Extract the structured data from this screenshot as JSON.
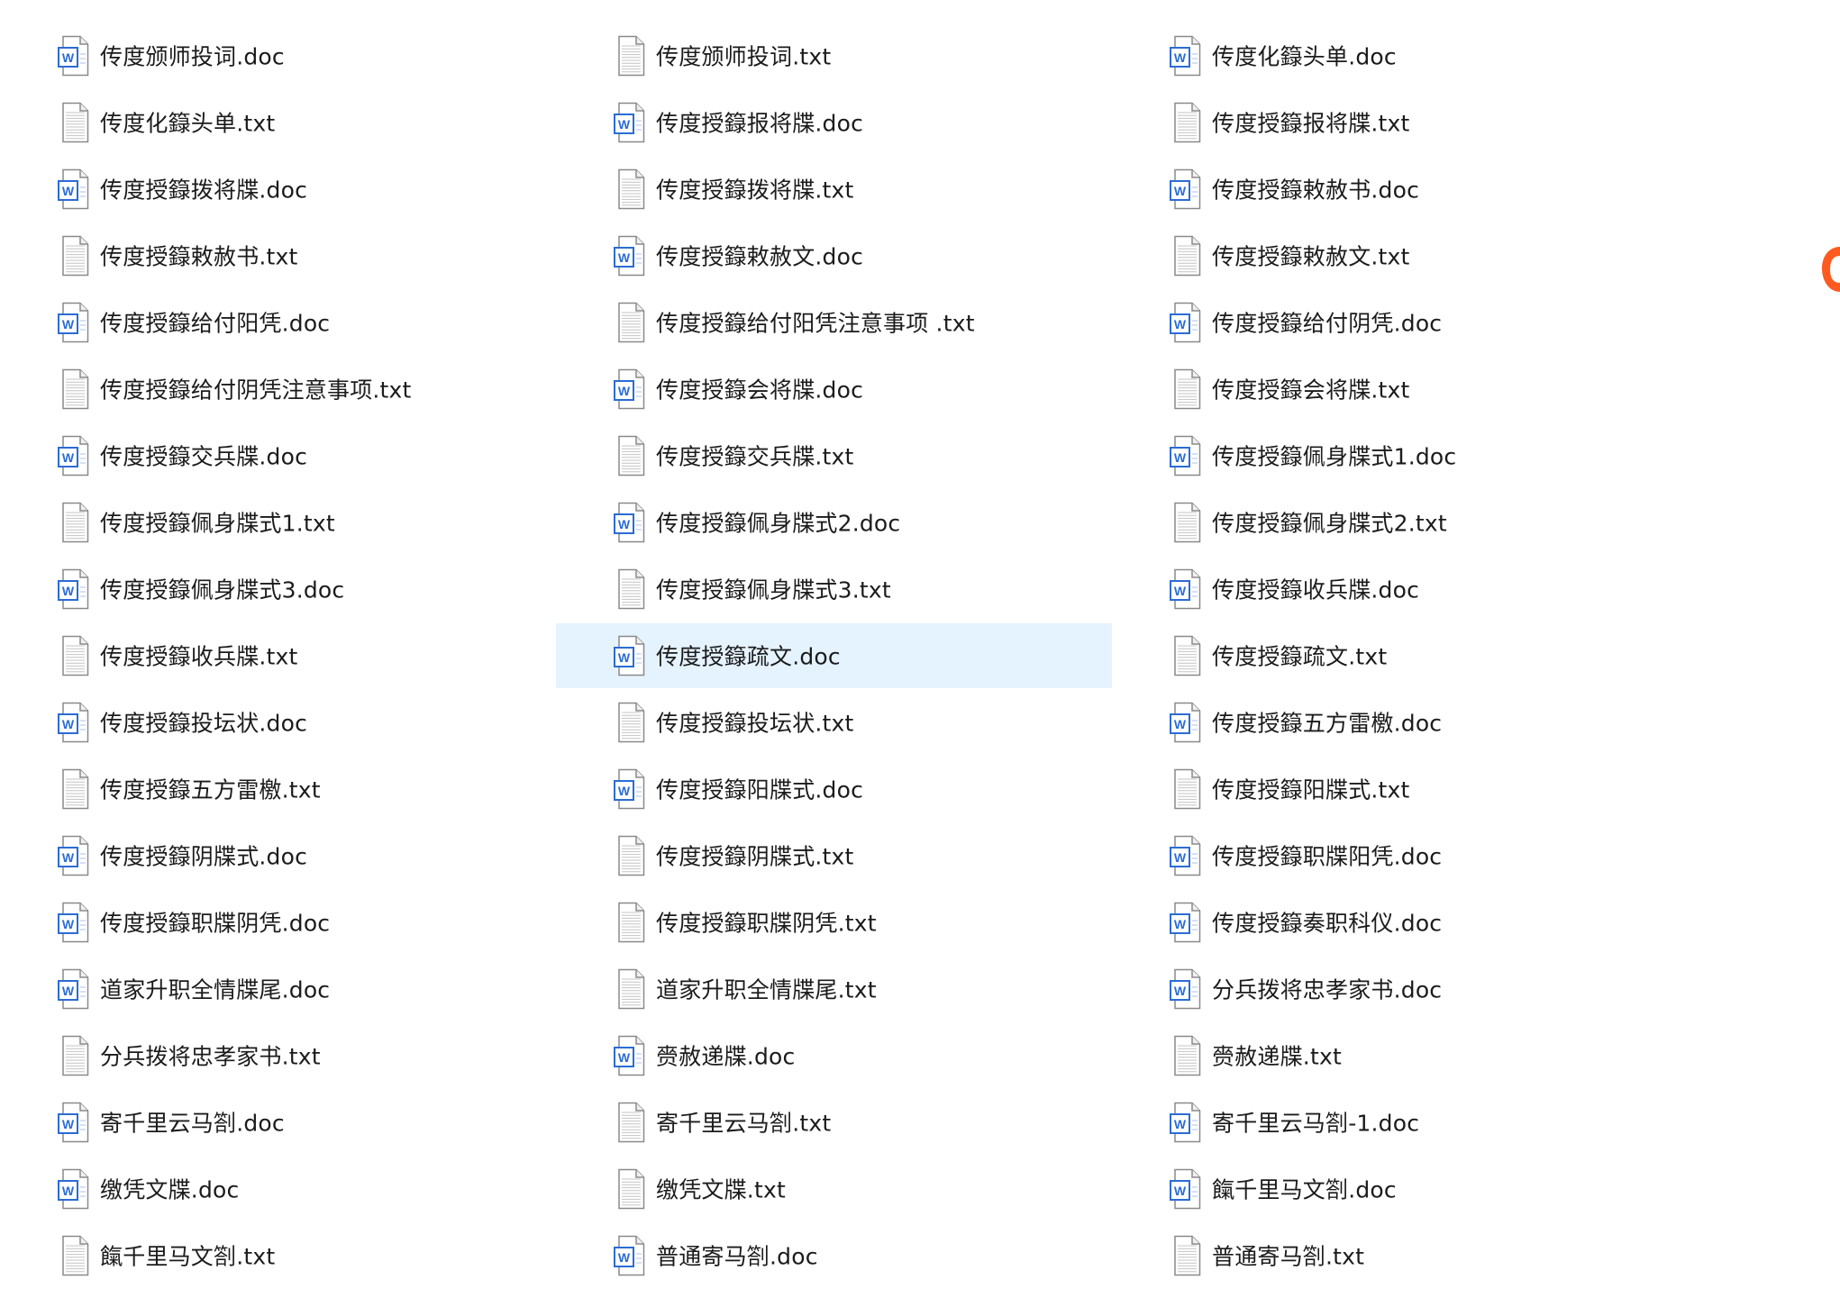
{
  "colors": {
    "selection": "#e5f3ff",
    "text": "#1b1b1b",
    "word_blue": "#2b6cd4",
    "edge_logo": "#ff5a1f"
  },
  "selected_file": "传度授籙疏文.doc",
  "files": [
    {
      "name": "传度颁师投词.doc",
      "type": "doc"
    },
    {
      "name": "传度颁师投词.txt",
      "type": "txt"
    },
    {
      "name": "传度化籙头单.doc",
      "type": "doc"
    },
    {
      "name": "传度化籙头单.txt",
      "type": "txt"
    },
    {
      "name": "传度授籙报将牒.doc",
      "type": "doc"
    },
    {
      "name": "传度授籙报将牒.txt",
      "type": "txt"
    },
    {
      "name": "传度授籙拨将牒.doc",
      "type": "doc"
    },
    {
      "name": "传度授籙拨将牒.txt",
      "type": "txt"
    },
    {
      "name": "传度授籙敕赦书.doc",
      "type": "doc"
    },
    {
      "name": "传度授籙敕赦书.txt",
      "type": "txt"
    },
    {
      "name": "传度授籙敕赦文.doc",
      "type": "doc"
    },
    {
      "name": "传度授籙敕赦文.txt",
      "type": "txt"
    },
    {
      "name": "传度授籙给付阳凭.doc",
      "type": "doc"
    },
    {
      "name": "传度授籙给付阳凭注意事项 .txt",
      "type": "txt"
    },
    {
      "name": "传度授籙给付阴凭.doc",
      "type": "doc"
    },
    {
      "name": "传度授籙给付阴凭注意事项.txt",
      "type": "txt"
    },
    {
      "name": "传度授籙会将牒.doc",
      "type": "doc"
    },
    {
      "name": "传度授籙会将牒.txt",
      "type": "txt"
    },
    {
      "name": "传度授籙交兵牒.doc",
      "type": "doc"
    },
    {
      "name": "传度授籙交兵牒.txt",
      "type": "txt"
    },
    {
      "name": "传度授籙佩身牒式1.doc",
      "type": "doc"
    },
    {
      "name": "传度授籙佩身牒式1.txt",
      "type": "txt"
    },
    {
      "name": "传度授籙佩身牒式2.doc",
      "type": "doc"
    },
    {
      "name": "传度授籙佩身牒式2.txt",
      "type": "txt"
    },
    {
      "name": "传度授籙佩身牒式3.doc",
      "type": "doc"
    },
    {
      "name": "传度授籙佩身牒式3.txt",
      "type": "txt"
    },
    {
      "name": "传度授籙收兵牒.doc",
      "type": "doc"
    },
    {
      "name": "传度授籙收兵牒.txt",
      "type": "txt"
    },
    {
      "name": "传度授籙疏文.doc",
      "type": "doc"
    },
    {
      "name": "传度授籙疏文.txt",
      "type": "txt"
    },
    {
      "name": "传度授籙投坛状.doc",
      "type": "doc"
    },
    {
      "name": "传度授籙投坛状.txt",
      "type": "txt"
    },
    {
      "name": "传度授籙五方雷檄.doc",
      "type": "doc"
    },
    {
      "name": "传度授籙五方雷檄.txt",
      "type": "txt"
    },
    {
      "name": "传度授籙阳牒式.doc",
      "type": "doc"
    },
    {
      "name": "传度授籙阳牒式.txt",
      "type": "txt"
    },
    {
      "name": "传度授籙阴牒式.doc",
      "type": "doc"
    },
    {
      "name": "传度授籙阴牒式.txt",
      "type": "txt"
    },
    {
      "name": "传度授籙职牒阳凭.doc",
      "type": "doc"
    },
    {
      "name": "传度授籙职牒阴凭.doc",
      "type": "doc"
    },
    {
      "name": "传度授籙职牒阴凭.txt",
      "type": "txt"
    },
    {
      "name": "传度授籙奏职科仪.doc",
      "type": "doc"
    },
    {
      "name": "道家升职全情牒尾.doc",
      "type": "doc"
    },
    {
      "name": "道家升职全情牒尾.txt",
      "type": "txt"
    },
    {
      "name": "分兵拨将忠孝家书.doc",
      "type": "doc"
    },
    {
      "name": "分兵拨将忠孝家书.txt",
      "type": "txt"
    },
    {
      "name": "赍赦递牒.doc",
      "type": "doc"
    },
    {
      "name": "赍赦递牒.txt",
      "type": "txt"
    },
    {
      "name": "寄千里云马劄.doc",
      "type": "doc"
    },
    {
      "name": "寄千里云马劄.txt",
      "type": "txt"
    },
    {
      "name": "寄千里云马劄-1.doc",
      "type": "doc"
    },
    {
      "name": "缴凭文牒.doc",
      "type": "doc"
    },
    {
      "name": "缴凭文牒.txt",
      "type": "txt"
    },
    {
      "name": "餼千里马文劄.doc",
      "type": "doc"
    },
    {
      "name": "餼千里马文劄.txt",
      "type": "txt"
    },
    {
      "name": "普通寄马劄.doc",
      "type": "doc"
    },
    {
      "name": "普通寄马劄.txt",
      "type": "txt"
    }
  ]
}
